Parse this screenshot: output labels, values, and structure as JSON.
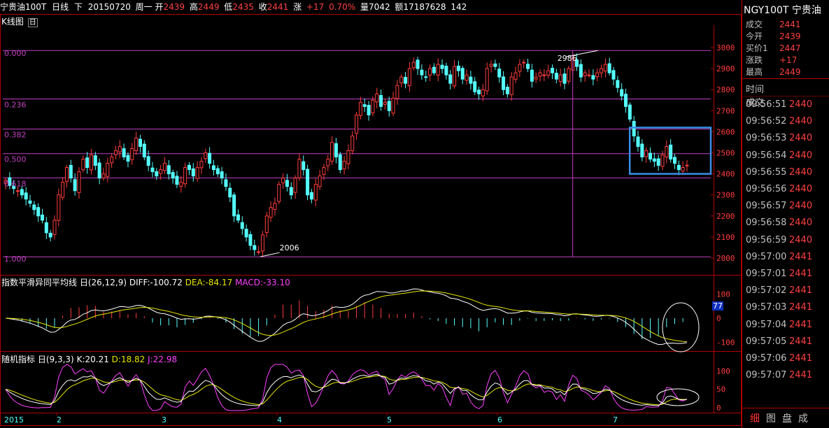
{
  "header": {
    "instrument": "宁贵油100T",
    "period": "日线",
    "direction_mark": "下",
    "date": "20150720",
    "weekday": "周一",
    "open_label": "开",
    "open": "2439",
    "high_label": "高",
    "high": "2449",
    "low_label": "低",
    "low": "2435",
    "close_label": "收",
    "close": "2441",
    "change_label": "涨",
    "change": "+17",
    "change_pct": "0.70%",
    "volume_label": "量",
    "volume": "7042",
    "amount_label": "额",
    "amount": "17187628",
    "extra": "142"
  },
  "panels": {
    "kline_title": "K线图",
    "kline_icon": "日",
    "macd_title": "指数平滑异同平均线",
    "macd_params": "日(26,12,9)",
    "macd_diff": "DIFF:-100.72",
    "macd_dea": "DEA:-84.17",
    "macd_macd": "MACD:-33.10",
    "macd_badge": "77",
    "kdj_title": "随机指标",
    "kdj_params": "日(9,3,3)",
    "kdj_k": "K:20.21",
    "kdj_d": "D:18.82",
    "kdj_j": "J:22.98"
  },
  "right_panel": {
    "title": "NGY100T 宁贵油",
    "quote": [
      {
        "label": "成交",
        "value": "2441"
      },
      {
        "label": "今开",
        "value": "2439"
      },
      {
        "label": "买价1",
        "value": "2447"
      },
      {
        "label": "涨跌",
        "value": "+17"
      },
      {
        "label": "最高",
        "value": "2449"
      }
    ],
    "ticks_header": {
      "time": "时间",
      "price": "成交"
    },
    "ticks": [
      {
        "time": "09:56:51",
        "price": "2440"
      },
      {
        "time": "09:56:52",
        "price": "2440"
      },
      {
        "time": "09:56:53",
        "price": "2440"
      },
      {
        "time": "09:56:54",
        "price": "2440"
      },
      {
        "time": "09:56:55",
        "price": "2440"
      },
      {
        "time": "09:56:56",
        "price": "2440"
      },
      {
        "time": "09:56:57",
        "price": "2440"
      },
      {
        "time": "09:56:58",
        "price": "2440"
      },
      {
        "time": "09:56:59",
        "price": "2440"
      },
      {
        "time": "09:57:00",
        "price": "2441"
      },
      {
        "time": "09:57:01",
        "price": "2441"
      },
      {
        "time": "09:57:02",
        "price": "2441"
      },
      {
        "time": "09:57:03",
        "price": "2441"
      },
      {
        "time": "09:57:04",
        "price": "2441"
      },
      {
        "time": "09:57:05",
        "price": "2441"
      },
      {
        "time": "09:57:06",
        "price": "2441"
      },
      {
        "time": "09:57:07",
        "price": "2441"
      }
    ],
    "buttons": [
      "细",
      "图",
      "盘",
      "成"
    ]
  },
  "colors": {
    "up": "#ff3c3c",
    "down": "#54ffff",
    "fib": "#c040c0",
    "dea": "#e6e600",
    "diff": "#ffffff",
    "j": "#ff40ff",
    "axis": "#b00000",
    "box": "#3a8ee6"
  },
  "chart_data": [
    {
      "type": "candlestick",
      "title": "K线图",
      "ylim": [
        2000,
        3000
      ],
      "y_ticks": [
        2000,
        2100,
        2200,
        2300,
        2400,
        2500,
        2600,
        2700,
        2800,
        2900,
        3000
      ],
      "x_ticks": [
        "2015",
        "2",
        "3",
        "4",
        "5",
        "6",
        "7"
      ],
      "fib_levels": [
        {
          "label": "0.000",
          "value": 2986
        },
        {
          "label": "0.236",
          "value": 2756
        },
        {
          "label": "0.382",
          "value": 2613
        },
        {
          "label": "0.500",
          "value": 2496
        },
        {
          "label": "0.618",
          "value": 2381
        },
        {
          "label": "1.000",
          "value": 2006
        }
      ],
      "annotations": [
        {
          "text": "2986",
          "value": 2986
        },
        {
          "text": "2006",
          "value": 2006
        }
      ],
      "series": [
        {
          "close": [
            2370,
            2345,
            2330,
            2320,
            2300,
            2280,
            2260,
            2230,
            2200,
            2180,
            2120,
            2100,
            2180,
            2300,
            2360,
            2430,
            2380,
            2320,
            2410,
            2470,
            2430,
            2490,
            2440,
            2380,
            2400,
            2450,
            2480,
            2510,
            2530,
            2480,
            2460,
            2520,
            2570,
            2530,
            2480,
            2440,
            2410,
            2390,
            2420,
            2450,
            2400,
            2380,
            2350,
            2360,
            2430,
            2420,
            2390,
            2430,
            2460,
            2500,
            2450,
            2420,
            2400,
            2380,
            2340,
            2290,
            2200,
            2180,
            2140,
            2100,
            2060,
            2040,
            2030,
            2110,
            2200,
            2240,
            2260,
            2350,
            2380,
            2340,
            2300,
            2380,
            2470,
            2420,
            2300,
            2280,
            2350,
            2390,
            2430,
            2470,
            2550,
            2480,
            2420,
            2460,
            2510,
            2580,
            2680,
            2740,
            2720,
            2680,
            2750,
            2780,
            2720,
            2740,
            2700,
            2760,
            2820,
            2860,
            2830,
            2900,
            2930,
            2900,
            2870,
            2860,
            2900,
            2880,
            2920,
            2900,
            2870,
            2830,
            2910,
            2890,
            2850,
            2870,
            2830,
            2790,
            2780,
            2800,
            2900,
            2920,
            2910,
            2860,
            2800,
            2780,
            2860,
            2880,
            2920,
            2930,
            2900,
            2840,
            2860,
            2880,
            2870,
            2890,
            2880,
            2850,
            2870,
            2830,
            2900,
            2950,
            2910,
            2860,
            2880,
            2870,
            2850,
            2880,
            2900,
            2920,
            2880,
            2850,
            2810,
            2770,
            2720,
            2660,
            2580,
            2530,
            2480,
            2510,
            2470,
            2460,
            2440,
            2490,
            2530,
            2470,
            2450,
            2420,
            2430,
            2441
          ]
        }
      ]
    },
    {
      "type": "bar+line",
      "title": "指数平滑异同平均线",
      "ylim": [
        -130,
        130
      ],
      "y_ticks": [
        100,
        0,
        -100
      ]
    },
    {
      "type": "line",
      "title": "随机指标",
      "ylim": [
        -10,
        120
      ],
      "y_ticks": [
        100,
        50,
        0
      ]
    }
  ]
}
